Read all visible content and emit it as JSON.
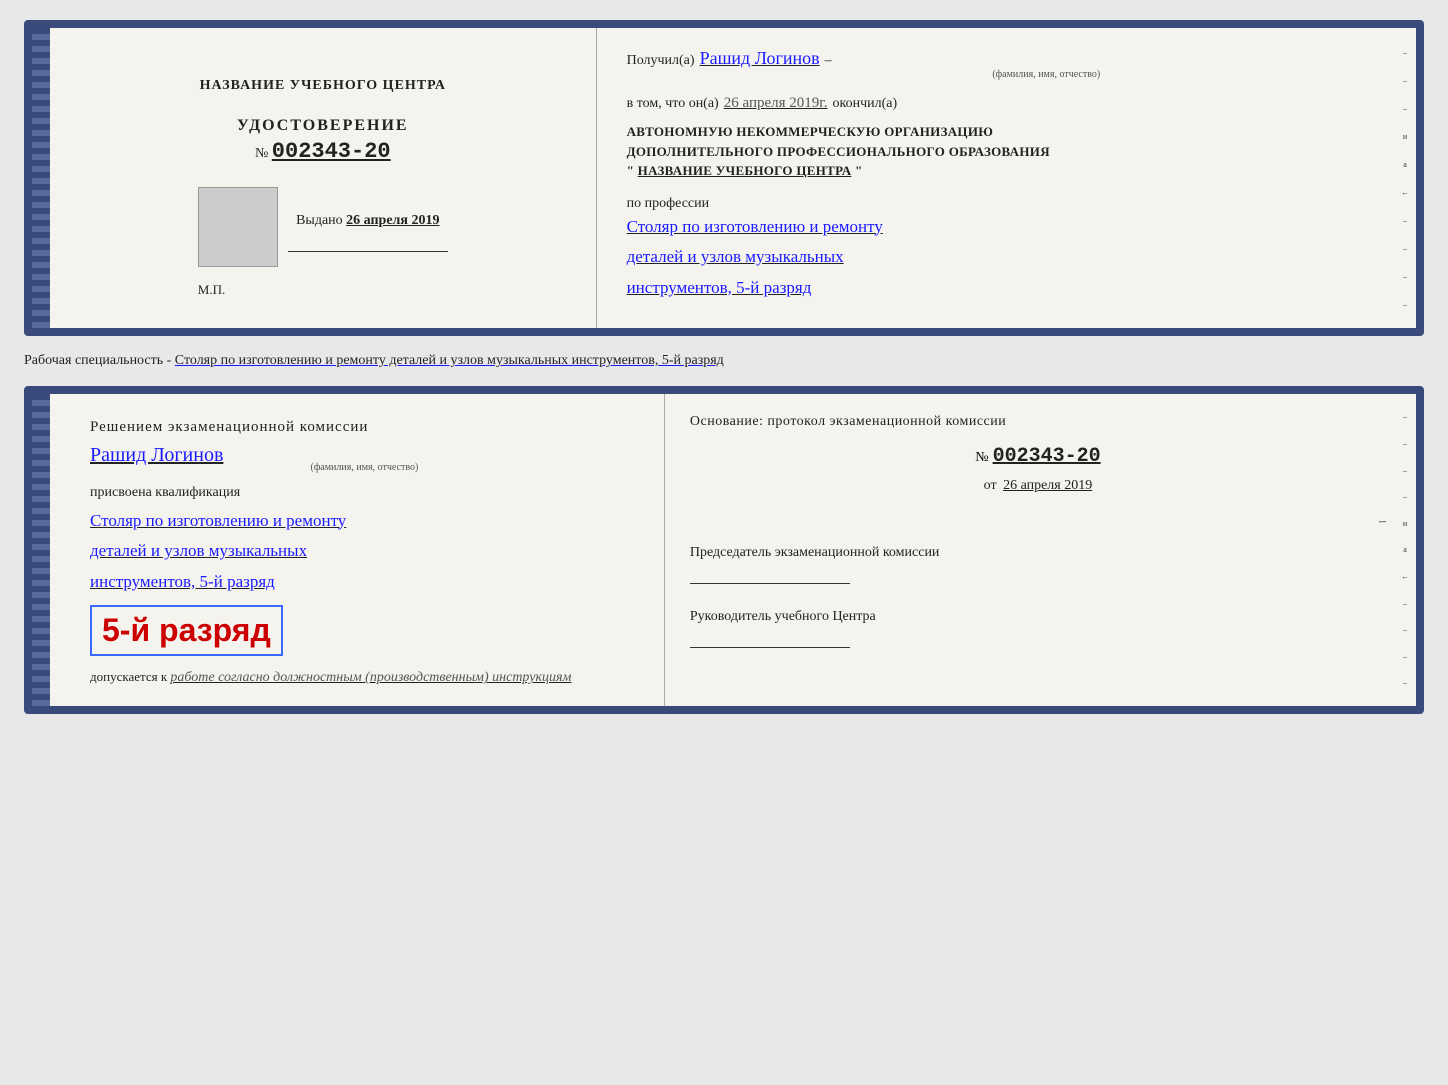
{
  "top_card": {
    "left": {
      "center_title": "НАЗВАНИЕ УЧЕБНОГО ЦЕНТРА",
      "cert_label": "УДОСТОВЕРЕНИЕ",
      "cert_number_prefix": "№",
      "cert_number": "002343-20",
      "issued_label": "Выдано",
      "issued_date": "26 апреля 2019",
      "mp_label": "М.П."
    },
    "right": {
      "received_label": "Получил(а)",
      "recipient_name": "Рашид Логинов",
      "name_hint": "(фамилия, имя, отчество)",
      "dash1": "–",
      "completed_prefix": "в том, что он(а)",
      "completed_date": "26 апреля 2019г.",
      "completed_label": "окончил(а)",
      "org_line1": "АВТОНОМНУЮ НЕКОММЕРЧЕСКУЮ ОРГАНИЗАЦИЮ",
      "org_line2": "ДОПОЛНИТЕЛЬНОГО ПРОФЕССИОНАЛЬНОГО ОБРАЗОВАНИЯ",
      "org_quote_open": "\"",
      "org_name": "НАЗВАНИЕ УЧЕБНОГО ЦЕНТРА",
      "org_quote_close": "\"",
      "profession_label": "по профессии",
      "profession_line1": "Столяр по изготовлению и ремонту",
      "profession_line2": "деталей и узлов музыкальных",
      "profession_line3": "инструментов, 5-й разряд"
    },
    "right_edge_labels": [
      "–",
      "–",
      "–",
      "и",
      "а",
      "←",
      "–",
      "–",
      "–",
      "–"
    ]
  },
  "between_text": "Рабочая специальность - Столяр по изготовлению и ремонту деталей и узлов музыкальных инструментов, 5-й разряд",
  "bottom_card": {
    "left": {
      "decision_title": "Решением экзаменационной комиссии",
      "person_name": "Рашид Логинов",
      "name_hint": "(фамилия, имя, отчество)",
      "assigned_label": "присвоена квалификация",
      "qualification_line1": "Столяр по изготовлению и ремонту",
      "qualification_line2": "деталей и узлов музыкальных",
      "qualification_line3": "инструментов, 5-й разряд",
      "rank_box_text": "5-й разряд",
      "allowed_prefix": "допускается к",
      "allowed_text": "работе согласно должностным (производственным) инструкциям"
    },
    "right": {
      "basis_label": "Основание: протокол экзаменационной комиссии",
      "protocol_number_prefix": "№",
      "protocol_number": "002343-20",
      "date_prefix": "от",
      "protocol_date": "26 апреля 2019",
      "dash1": "–",
      "commission_title": "Председатель экзаменационной комиссии",
      "center_head_title": "Руководитель учебного Центра"
    },
    "right_edge_labels": [
      "–",
      "–",
      "–",
      "–",
      "и",
      "а",
      "←",
      "–",
      "–",
      "–",
      "–"
    ]
  }
}
